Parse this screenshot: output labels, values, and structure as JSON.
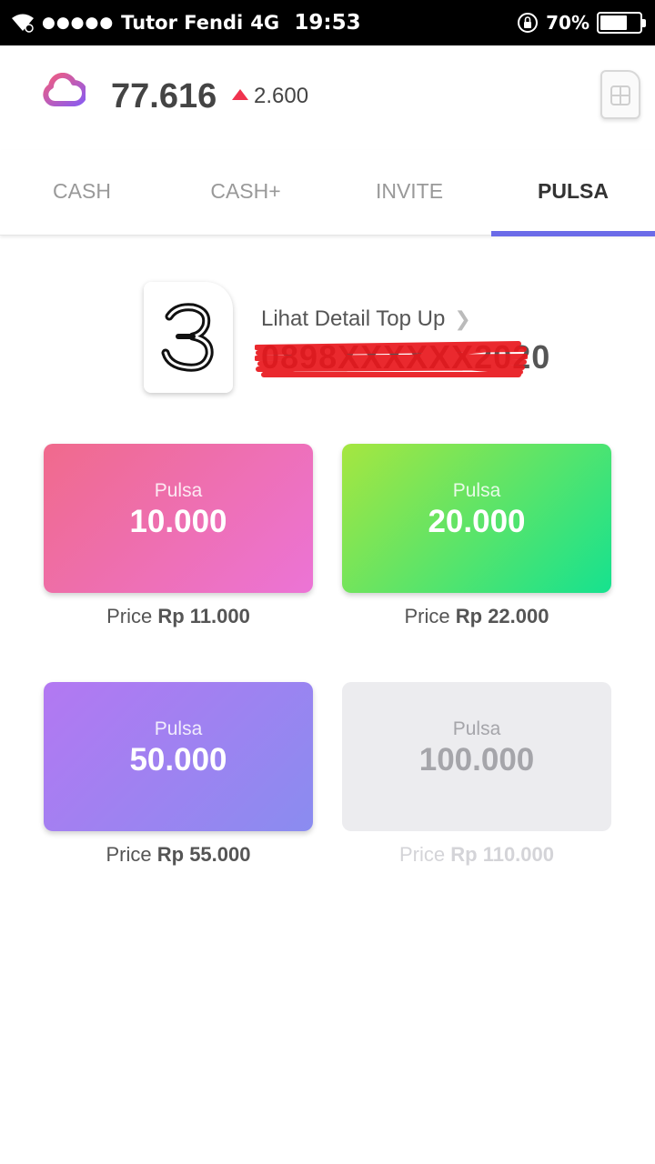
{
  "status_bar": {
    "signal_dots": "●●●●●",
    "carrier": "Tutor Fendi",
    "network": "4G",
    "time": "19:53",
    "battery_percent": "70%",
    "battery_level": 0.7
  },
  "header": {
    "balance": "77.616",
    "delta": "2.600",
    "delta_color": "#f0334e",
    "logo_icon": "cloud-pin-logo",
    "sim_icon": "sim-card-icon"
  },
  "tabs": [
    {
      "label": "CASH"
    },
    {
      "label": "CASH+"
    },
    {
      "label": "INVITE"
    },
    {
      "label": "PULSA",
      "active": true
    }
  ],
  "tab_accent": "#6b6be8",
  "operator": {
    "logo_icon": "tri-3-logo",
    "detail_link": "Lihat Detail Top Up",
    "phone_number": "0898XXXXXX2020"
  },
  "packages": [
    {
      "label": "Pulsa",
      "amount": "10.000",
      "price_prefix": "Price",
      "price": "Rp 11.000",
      "enabled": true
    },
    {
      "label": "Pulsa",
      "amount": "20.000",
      "price_prefix": "Price",
      "price": "Rp 22.000",
      "enabled": true
    },
    {
      "label": "Pulsa",
      "amount": "50.000",
      "price_prefix": "Price",
      "price": "Rp 55.000",
      "enabled": true
    },
    {
      "label": "Pulsa",
      "amount": "100.000",
      "price_prefix": "Price",
      "price": "Rp 110.000",
      "enabled": false
    }
  ]
}
